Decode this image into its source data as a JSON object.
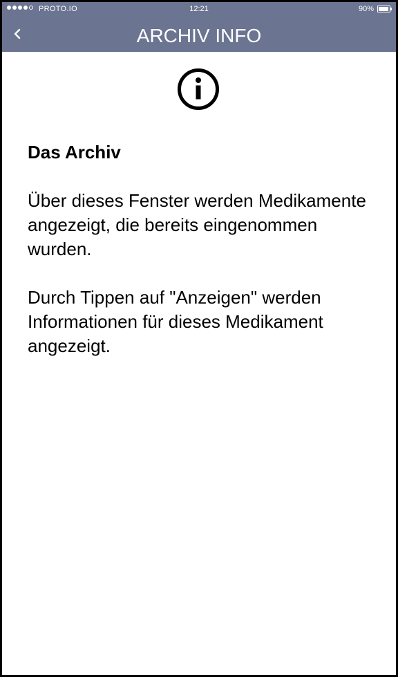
{
  "status_bar": {
    "carrier": "PROTO.IO",
    "time": "12:21",
    "battery_percent": "90%",
    "battery_level": 0.9,
    "signal_filled": 4,
    "signal_total": 5
  },
  "navbar": {
    "back_icon": "chevron-left-icon",
    "title": "ARCHIV INFO"
  },
  "info_icon": "info-circle-icon",
  "content": {
    "heading": "Das Archiv",
    "paragraphs": [
      "Über dieses Fenster werden Medikamente angezeigt, die bereits eingenommen wurden.",
      "Durch Tippen auf \"Anzeigen\" werden Informationen für dieses Medikament angezeigt."
    ]
  },
  "colors": {
    "header_bg": "#6b7491",
    "header_text": "#ffffff",
    "body_bg": "#ffffff",
    "text": "#000000"
  }
}
